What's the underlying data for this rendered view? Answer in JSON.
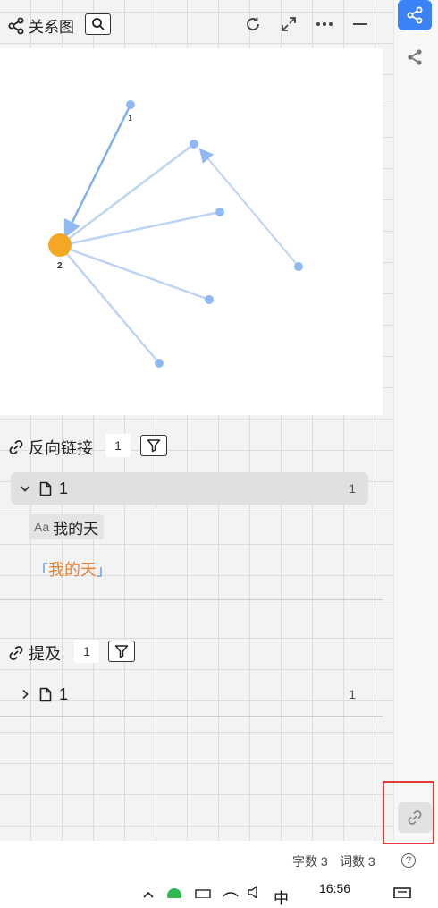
{
  "graph": {
    "title": "关系图",
    "center_node_label": "2",
    "top_node_label": "1",
    "accent_color": "#f5a623",
    "node_color": "#8fb9f2"
  },
  "backlinks": {
    "title": "反向链接",
    "count": "1",
    "doc": {
      "name": "1",
      "count": "1"
    },
    "block_prefix": "Aa",
    "block_text": "我的天",
    "quote_open": "「",
    "quote_text": "我的天",
    "quote_close": "」"
  },
  "mentions": {
    "title": "提及",
    "count": "1",
    "doc": {
      "name": "1",
      "count": "1"
    }
  },
  "status_bar": {
    "chars": "字数 3",
    "words": "词数 3",
    "help": "?"
  },
  "taskbar": {
    "time": "16:56",
    "ime": "中"
  },
  "colors": {
    "active_side_button": "#3b82f6",
    "highlight_border": "#e53935"
  }
}
